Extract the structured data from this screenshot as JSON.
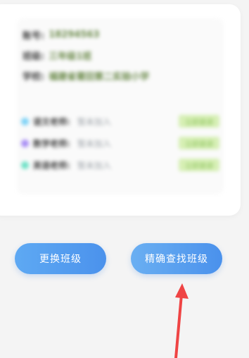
{
  "info": {
    "rows": [
      {
        "label": "账号:",
        "value": "18294563"
      },
      {
        "label": "班级:",
        "value": "三年级1班"
      },
      {
        "label": "学校:",
        "value": "福建省莆田第二实验小学"
      }
    ]
  },
  "teachers": [
    {
      "label": "语文老师:",
      "name": "暂未加入",
      "badge": "立即邀请",
      "dot_color": "#7fd3f7"
    },
    {
      "label": "数学老师:",
      "name": "暂未加入",
      "badge": "立即邀请",
      "dot_color": "#a98ef5"
    },
    {
      "label": "英语老师:",
      "name": "暂未加入",
      "badge": "立即邀请",
      "dot_color": "#6fe2c7"
    }
  ],
  "buttons": {
    "change_class": "更换班级",
    "search_class": "精确查找班级"
  },
  "colors": {
    "accent": "#4a91ec",
    "annotation_arrow": "#ef4444"
  }
}
